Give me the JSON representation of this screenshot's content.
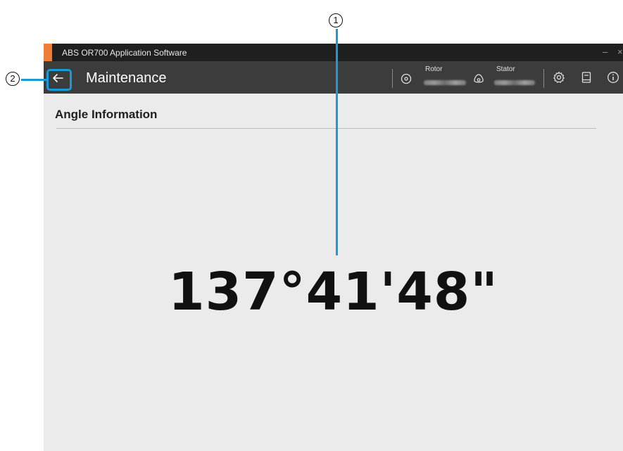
{
  "window": {
    "title": "ABS OR700 Application Software",
    "minimize": "–",
    "close": "×"
  },
  "header": {
    "title": "Maintenance",
    "rotor_label": "Rotor",
    "stator_label": "Stator"
  },
  "section": {
    "title": "Angle Information"
  },
  "angle": {
    "value": "137°41'48\""
  },
  "callouts": {
    "one": "1",
    "two": "2"
  },
  "colors": {
    "accent": "#1a9ad6",
    "brand": "#ee7d35",
    "header_bg": "#3c3c3c",
    "titlebar_bg": "#1f1f1f",
    "content_bg": "#ebebeb"
  },
  "icons": [
    "back-arrow-icon",
    "rotor-icon",
    "stator-icon",
    "gear-icon",
    "manual-icon",
    "info-icon"
  ]
}
